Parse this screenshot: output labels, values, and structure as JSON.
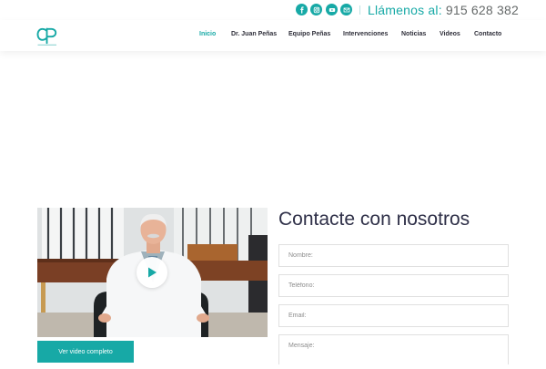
{
  "topbar": {
    "social_icons": [
      "facebook-icon",
      "instagram-icon",
      "youtube-icon",
      "email-icon"
    ],
    "phone_label": "Llámenos al:",
    "phone_number": "915 628 382"
  },
  "header": {
    "logo": "cp-logo",
    "nav": [
      "Inicio",
      "Dr. Juan Peñas",
      "Equipo Peñas",
      "Intervenciones",
      "Noticias",
      "Videos",
      "Contacto"
    ],
    "active_nav": "Inicio"
  },
  "video": {
    "button_label": "Ver video completo"
  },
  "contact": {
    "title": "Contacte con nosotros",
    "name_placeholder": "Nombre:",
    "phone_placeholder": "Teléfono:",
    "email_placeholder": "Email:",
    "message_placeholder": "Mensaje:"
  },
  "colors": {
    "accent": "#17a9a6",
    "heading": "#2f3048",
    "nav_text": "#2f2f3a"
  }
}
